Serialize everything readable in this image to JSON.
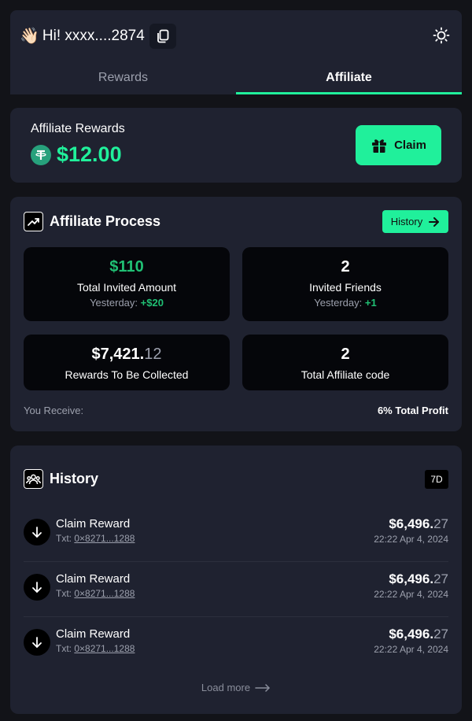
{
  "header": {
    "wave_emoji": "👋🏻",
    "greeting": "Hi! xxxx....2874",
    "icons": {
      "copy": "copy-icon",
      "theme": "sun-icon"
    }
  },
  "tabs": [
    {
      "label": "Rewards",
      "active": false
    },
    {
      "label": "Affiliate",
      "active": true
    }
  ],
  "rewards": {
    "label": "Affiliate Rewards",
    "amount": "$12.00",
    "token_icon": "tether-icon",
    "claim_label": "Claim"
  },
  "process": {
    "title": "Affiliate Process",
    "history_btn": "History",
    "stats": {
      "invited_amount": {
        "value": "$110",
        "caption": "Total Invited Amount",
        "sub_label": "Yesterday:",
        "sub_value": "+$20"
      },
      "invited_friends": {
        "value": "2",
        "caption": "Invited Friends",
        "sub_label": "Yesterday:",
        "sub_value": "+1"
      },
      "to_collect": {
        "value_main": "$7,421.",
        "value_cents": "12",
        "caption": "Rewards To Be Collected"
      },
      "affiliate_codes": {
        "value": "2",
        "caption": "Total Affiliate code"
      }
    },
    "receive_label": "You Receive:",
    "receive_value": "6% Total Profit"
  },
  "history": {
    "title": "History",
    "timeframe": "7D",
    "rows": [
      {
        "title": "Claim Reward",
        "tx_label": "Txt:",
        "tx": "0×8271...1288",
        "amount_main": "$6,496.",
        "amount_cents": "27",
        "date": "22:22 Apr 4, 2024"
      },
      {
        "title": "Claim Reward",
        "tx_label": "Txt:",
        "tx": "0×8271...1288",
        "amount_main": "$6,496.",
        "amount_cents": "27",
        "date": "22:22 Apr 4, 2024"
      },
      {
        "title": "Claim Reward",
        "tx_label": "Txt:",
        "tx": "0×8271...1288",
        "amount_main": "$6,496.",
        "amount_cents": "27",
        "date": "22:22 Apr 4, 2024"
      }
    ],
    "load_more": "Load more"
  },
  "colors": {
    "accent": "#20f09b",
    "positive": "#20c074",
    "card": "#1f2230",
    "background": "#121318"
  }
}
